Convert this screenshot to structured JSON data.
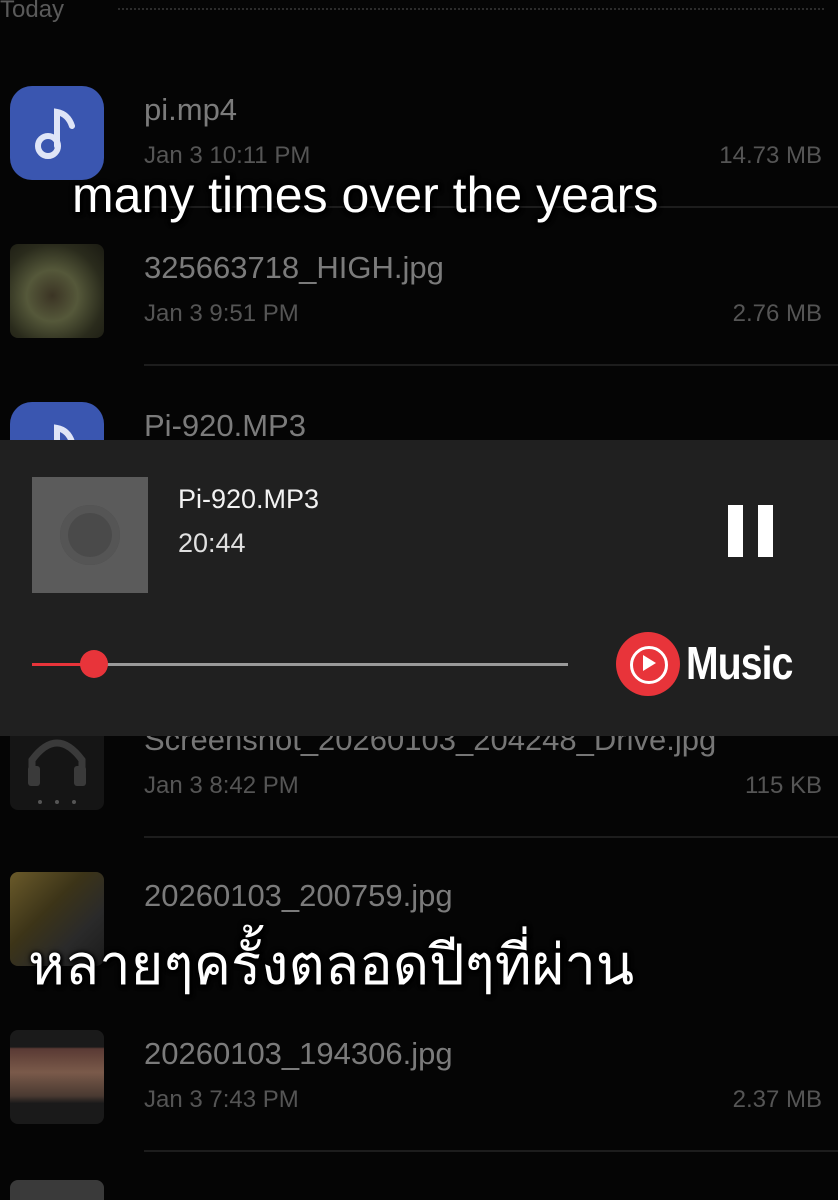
{
  "section": {
    "label": "Today"
  },
  "files": [
    {
      "name": "pi.mp4",
      "date": "Jan 3 10:11 PM",
      "size": "14.73 MB",
      "thumb": "music-note-icon"
    },
    {
      "name": "325663718_HIGH.jpg",
      "date": "Jan 3 9:51 PM",
      "size": "2.76 MB",
      "thumb": "image-thumbnail"
    },
    {
      "name": "Pi-920.MP3",
      "date": "",
      "size": "",
      "thumb": "music-note-icon"
    },
    {
      "name": "Screenshot_20260103_204248_Drive.jpg",
      "date": "Jan 3 8:42 PM",
      "size": "115 KB",
      "thumb": "image-thumbnail"
    },
    {
      "name": "20260103_200759.jpg",
      "date": "",
      "size": "",
      "thumb": "image-thumbnail"
    },
    {
      "name": "20260103_194306.jpg",
      "date": "Jan 3 7:43 PM",
      "size": "2.37 MB",
      "thumb": "image-thumbnail"
    }
  ],
  "player": {
    "track": "Pi-920.MP3",
    "time": "20:44",
    "progress": 0.115,
    "brand": "Music",
    "accent": "#e8343a"
  },
  "captions": {
    "english": "many times over the years",
    "thai": "หลายๆครั้งตลอดปีๆที่ผ่าน"
  }
}
